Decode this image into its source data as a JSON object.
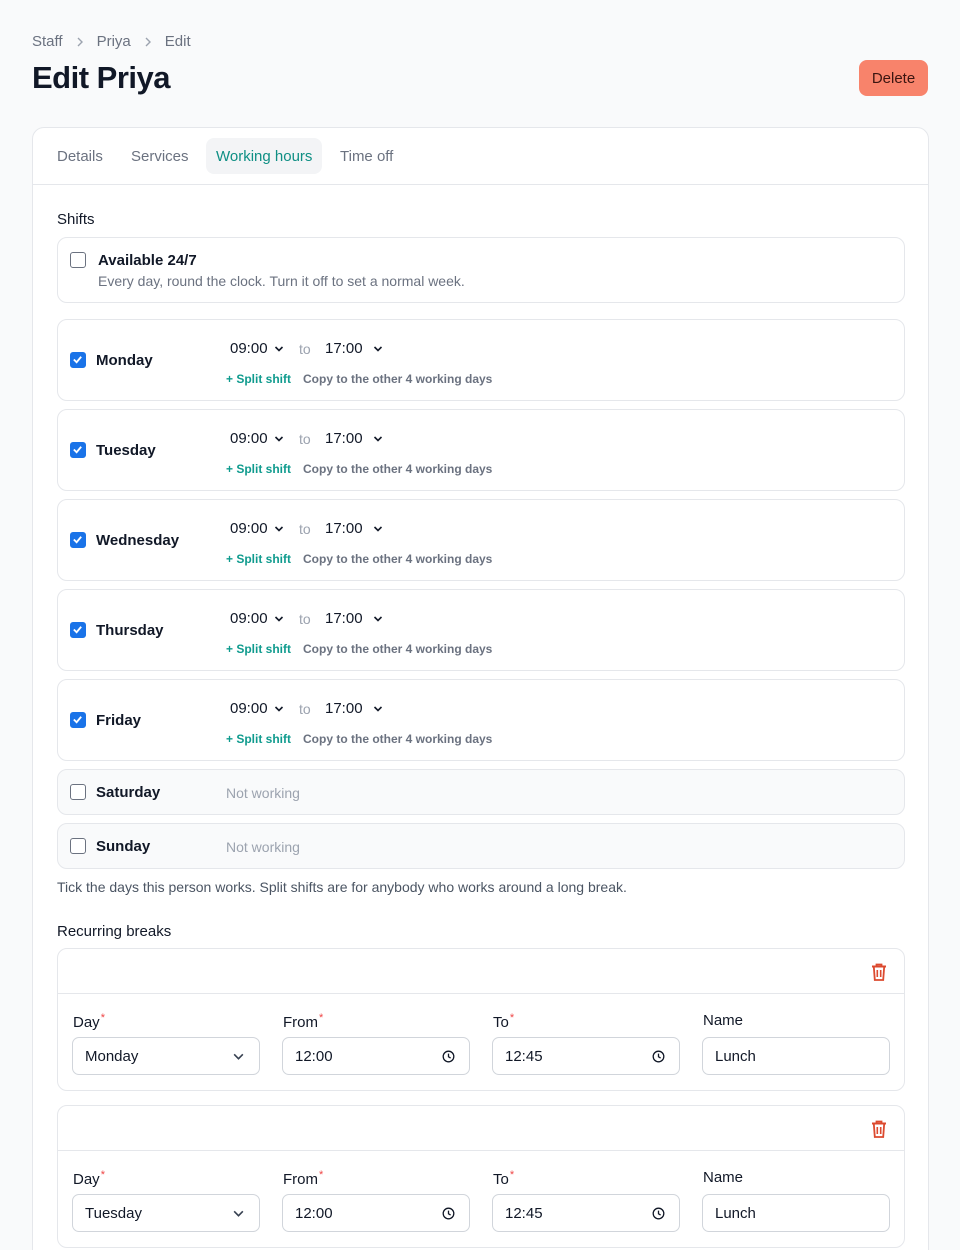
{
  "breadcrumb": [
    "Staff",
    "Priya",
    "Edit"
  ],
  "page_title": "Edit Priya",
  "delete_label": "Delete",
  "tabs": [
    {
      "label": "Details",
      "active": false
    },
    {
      "label": "Services",
      "active": false
    },
    {
      "label": "Working hours",
      "active": true
    },
    {
      "label": "Time off",
      "active": false
    }
  ],
  "shifts": {
    "label": "Shifts",
    "always_available": {
      "checked": false,
      "title": "Available 24/7",
      "description": "Every day, round the clock. Turn it off to set a normal week."
    },
    "days": [
      {
        "name": "Monday",
        "checked": true,
        "start": "09:00",
        "end": "17:00"
      },
      {
        "name": "Tuesday",
        "checked": true,
        "start": "09:00",
        "end": "17:00"
      },
      {
        "name": "Wednesday",
        "checked": true,
        "start": "09:00",
        "end": "17:00"
      },
      {
        "name": "Thursday",
        "checked": true,
        "start": "09:00",
        "end": "17:00"
      },
      {
        "name": "Friday",
        "checked": true,
        "start": "09:00",
        "end": "17:00"
      },
      {
        "name": "Saturday",
        "checked": false,
        "status": "Not working"
      },
      {
        "name": "Sunday",
        "checked": false,
        "status": "Not working"
      }
    ],
    "to_word": "to",
    "split_label": "+ Split shift",
    "copy_label": "Copy to the other 4 working days",
    "helper": "Tick the days this person works. Split shifts are for anybody who works around a long break."
  },
  "breaks": {
    "label": "Recurring breaks",
    "day_label": "Day",
    "from_label": "From",
    "to_label": "To",
    "name_label": "Name",
    "required_mark": "*",
    "items": [
      {
        "day": "Monday",
        "from": "12:00",
        "to": "12:45",
        "name": "Lunch"
      },
      {
        "day": "Tuesday",
        "from": "12:00",
        "to": "12:45",
        "name": "Lunch"
      }
    ]
  },
  "colors": {
    "accent": "#0f8f84",
    "checkbox": "#1a73e8",
    "delete": "#f8836b",
    "trash": "#dc4a2f"
  }
}
